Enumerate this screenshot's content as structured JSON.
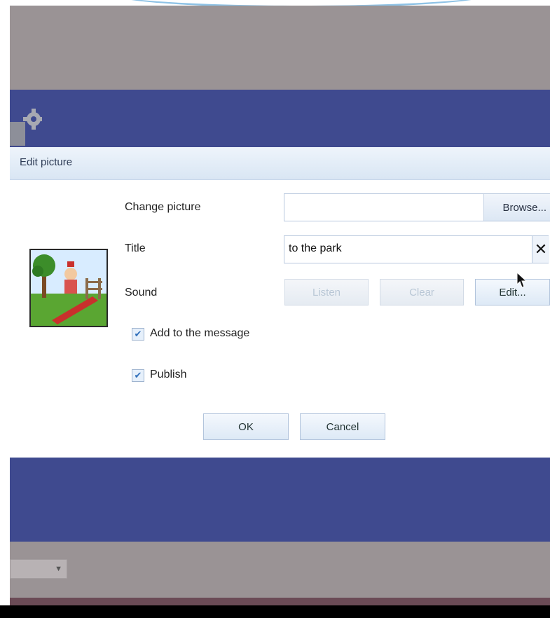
{
  "dialog": {
    "title": "Edit picture",
    "change_picture_label": "Change picture",
    "browse_label": "Browse...",
    "title_label": "Title",
    "title_value": "to the park",
    "sound_label": "Sound",
    "listen_label": "Listen",
    "clear_label": "Clear",
    "edit_label": "Edit...",
    "add_to_message_label": "Add to the message",
    "add_to_message_checked": true,
    "publish_label": "Publish",
    "publish_checked": true,
    "ok_label": "OK",
    "cancel_label": "Cancel"
  },
  "icons": {
    "clear_title": "close-icon",
    "settings": "gear-icon",
    "checkbox": "checkmark-icon",
    "combo": "chevron-down-icon"
  },
  "colors": {
    "band_blue": "#3f4a8f",
    "backdrop_grey": "#9a9395",
    "titlebar": "#dde8f5",
    "button_border": "#b2c4dc"
  }
}
